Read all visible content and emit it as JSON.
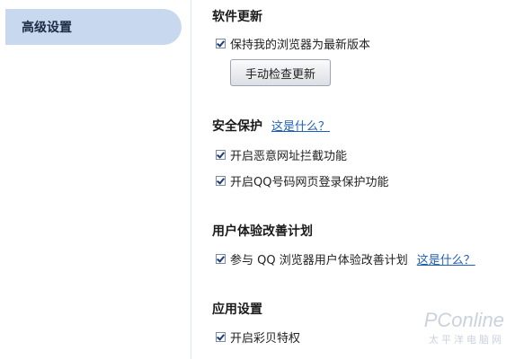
{
  "sidebar": {
    "items": [
      {
        "label": "高级设置"
      }
    ]
  },
  "sections": {
    "update": {
      "title": "软件更新",
      "keep_latest": {
        "label": "保持我的浏览器为最新版本",
        "checked": true
      },
      "check_button": "手动检查更新"
    },
    "security": {
      "title": "安全保护",
      "help": "这是什么？",
      "malicious_block": {
        "label": "开启恶意网址拦截功能",
        "checked": true
      },
      "qq_login_protect": {
        "label": "开启QQ号码网页登录保护功能",
        "checked": true
      }
    },
    "ux_program": {
      "title": "用户体验改善计划",
      "join": {
        "label": "参与 QQ 浏览器用户体验改善计划",
        "checked": true
      },
      "help": "这是什么？"
    },
    "apps": {
      "title": "应用设置",
      "caibei": {
        "label": "开启彩贝特权",
        "checked": true
      }
    }
  },
  "watermark": {
    "main": "PConline",
    "sub": "太平洋电脑网"
  }
}
